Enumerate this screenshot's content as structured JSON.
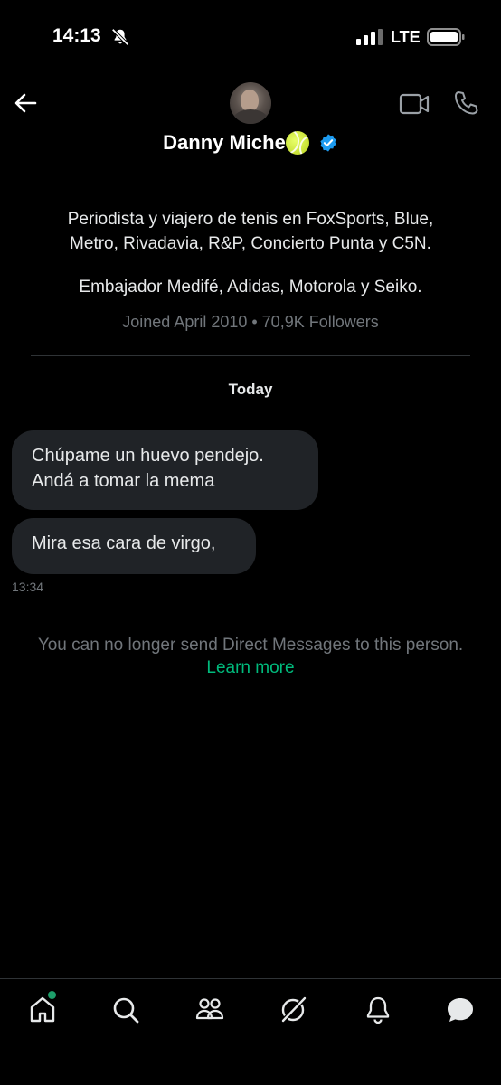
{
  "status_bar": {
    "time": "14:13",
    "network": "LTE",
    "icons": [
      "bell-off-icon",
      "signal-icon",
      "battery-icon"
    ]
  },
  "header": {
    "name": "Danny Miche",
    "name_emoji": "tennis-ball-icon",
    "verified": true,
    "icons": [
      "back-arrow-icon",
      "video-call-icon",
      "phone-call-icon"
    ]
  },
  "profile": {
    "bio_line1": "Periodista y viajero de tenis en FoxSports, Blue,",
    "bio_line2": "Metro, Rivadavia, R&P, Concierto Punta y C5N.",
    "bio_line3": "Embajador Medifé, Adidas, Motorola y Seiko.",
    "joined": "Joined April 2010 • 70,9K Followers"
  },
  "conversation": {
    "date_label": "Today",
    "messages": [
      {
        "line1": "Chúpame un huevo pendejo.",
        "line2": "Andá a tomar la mema"
      },
      {
        "line1": "Mira esa cara de virgo,"
      }
    ],
    "timestamp": "13:34"
  },
  "notice": {
    "text": "You can no longer send Direct Messages to this person.",
    "link": "Learn more"
  },
  "colors": {
    "background": "#000000",
    "bubble": "#202327",
    "muted": "#71767b",
    "link": "#00ba7c",
    "verified": "#1d9bf0"
  },
  "bottom_nav": {
    "items": [
      "home-icon",
      "search-icon",
      "communities-icon",
      "grok-icon",
      "notifications-icon",
      "messages-icon"
    ],
    "active": "messages-icon"
  }
}
